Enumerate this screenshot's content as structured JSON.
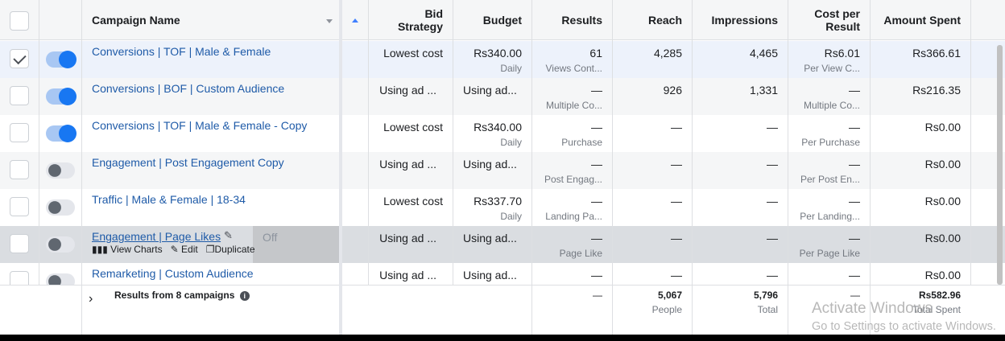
{
  "header": {
    "campaign_name": "Campaign Name",
    "bid_strategy_1": "Bid",
    "bid_strategy_2": "Strategy",
    "budget": "Budget",
    "results": "Results",
    "reach": "Reach",
    "impressions": "Impressions",
    "cpr_1": "Cost per",
    "cpr_2": "Result",
    "amount_spent": "Amount Spent"
  },
  "rows": [
    {
      "name": "Conversions | TOF | Male & Female",
      "bid": "Lowest cost",
      "budget": "Rs340.00",
      "budget_sub": "Daily",
      "results": "61",
      "results_sub": "Views Cont...",
      "reach": "4,285",
      "impressions": "4,465",
      "cpr": "Rs6.01",
      "cpr_sub": "Per View C...",
      "spent": "Rs366.61"
    },
    {
      "name": "Conversions | BOF | Custom Audience",
      "bid": "Using ad ...",
      "budget": "Using ad...",
      "budget_sub": "",
      "results": "—",
      "results_sub": "Multiple Co...",
      "reach": "926",
      "impressions": "1,331",
      "cpr": "—",
      "cpr_sub": "Multiple Co...",
      "spent": "Rs216.35"
    },
    {
      "name": "Conversions | TOF | Male & Female - Copy",
      "bid": "Lowest cost",
      "budget": "Rs340.00",
      "budget_sub": "Daily",
      "results": "—",
      "results_sub": "Purchase",
      "reach": "—",
      "impressions": "—",
      "cpr": "—",
      "cpr_sub": "Per Purchase",
      "spent": "Rs0.00"
    },
    {
      "name": "Engagement | Post Engagement Copy",
      "bid": "Using ad ...",
      "budget": "Using ad...",
      "budget_sub": "",
      "results": "—",
      "results_sub": "Post Engag...",
      "reach": "—",
      "impressions": "—",
      "cpr": "—",
      "cpr_sub": "Per Post En...",
      "spent": "Rs0.00"
    },
    {
      "name": "Traffic | Male & Female | 18-34",
      "bid": "Lowest cost",
      "budget": "Rs337.70",
      "budget_sub": "Daily",
      "results": "—",
      "results_sub": "Landing Pa...",
      "reach": "—",
      "impressions": "—",
      "cpr": "—",
      "cpr_sub": "Per Landing...",
      "spent": "Rs0.00"
    },
    {
      "name": "Engagement | Page Likes",
      "bid": "Using ad ...",
      "budget": "Using ad...",
      "budget_sub": "",
      "results": "—",
      "results_sub": "Page Like",
      "reach": "—",
      "impressions": "—",
      "cpr": "—",
      "cpr_sub": "Per Page Like",
      "spent": "Rs0.00"
    },
    {
      "name": "Remarketing | Custom Audience",
      "bid": "Using ad ...",
      "budget": "Using ad...",
      "budget_sub": "",
      "results": "—",
      "results_sub": "",
      "reach": "—",
      "impressions": "—",
      "cpr": "—",
      "cpr_sub": "",
      "spent": "Rs0.00"
    }
  ],
  "hover_actions": {
    "status": "Off",
    "view_charts": "View Charts",
    "edit": "Edit",
    "duplicate": "Duplicate"
  },
  "footer": {
    "label": "Results from 8 campaigns",
    "results": "—",
    "reach": "5,067",
    "reach_sub": "People",
    "impressions": "5,796",
    "impressions_sub": "Total",
    "cpr": "—",
    "spent": "Rs582.96",
    "spent_sub": "Total Spent"
  },
  "watermark": {
    "line1": "Activate Windows",
    "line2": "Go to Settings to activate Windows."
  },
  "colors": {
    "accent": "#1877f2",
    "link": "#1f5ba8",
    "selected_row": "#edf2fb"
  }
}
